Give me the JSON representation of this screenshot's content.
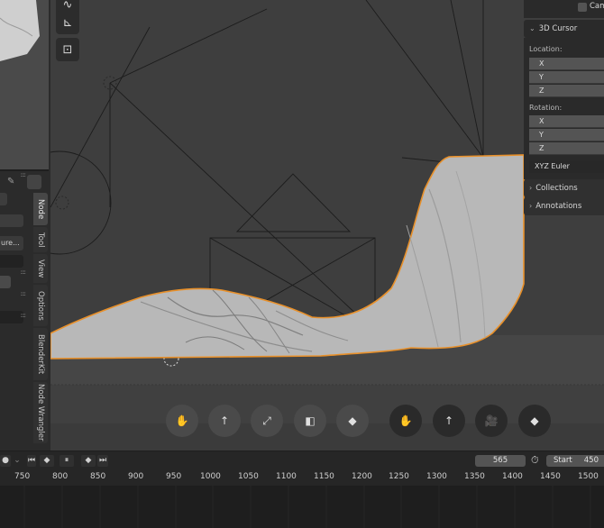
{
  "left_panel": {
    "truncated_text": "ure...",
    "dots": "::::"
  },
  "sidebar_tabs": [
    "Node",
    "Tool",
    "View",
    "Options",
    "BlenderKit",
    "Node Wrangler"
  ],
  "npanel": {
    "top_label": "Cam",
    "cursor_section": "3D Cursor",
    "location_label": "Location:",
    "rotation_label": "Rotation:",
    "axis_x": "X",
    "axis_y": "Y",
    "axis_z": "Z",
    "rotation_mode": "XYZ Euler",
    "collections_section": "Collections",
    "annotations_section": "Annotations"
  },
  "nav_buttons": [
    {
      "icon": "hand-icon",
      "glyph": "✋"
    },
    {
      "icon": "arrow-up-icon",
      "glyph": "↑"
    },
    {
      "icon": "expand-icon",
      "glyph": "⤢"
    },
    {
      "icon": "cube-face-icon",
      "glyph": "◧"
    },
    {
      "icon": "keyframe-icon",
      "glyph": "◆"
    },
    {
      "icon": "hand-icon",
      "glyph": "✋"
    },
    {
      "icon": "arrow-up-icon",
      "glyph": "↑"
    },
    {
      "icon": "camera-icon",
      "glyph": "🎥"
    },
    {
      "icon": "keyframe-icon",
      "glyph": "◆"
    }
  ],
  "timeline": {
    "current_frame": "565",
    "start_label": "Start",
    "start_value": "450",
    "ticks": [
      "750",
      "800",
      "850",
      "900",
      "950",
      "1000",
      "1050",
      "1100",
      "1150",
      "1200",
      "1250",
      "1300",
      "1350",
      "1400",
      "1450",
      "1500"
    ]
  },
  "colors": {
    "viewport_bg": "#3e3e3e",
    "mesh": "#b8b8b8",
    "selection_outline": "#e8902a",
    "panel_bg": "#2b2b2b"
  }
}
